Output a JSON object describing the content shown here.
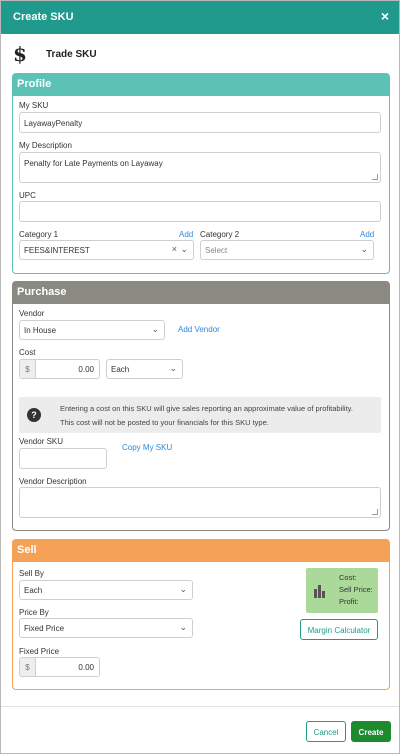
{
  "header": {
    "title": "Create SKU",
    "close_glyph": "×"
  },
  "sku_type": {
    "icon": "dollar-icon",
    "glyph": "$",
    "label": "Trade SKU"
  },
  "profile": {
    "title": "Profile",
    "my_sku_label": "My SKU",
    "my_sku_value": "LayawayPenalty",
    "description_label": "My Description",
    "description_value": "Penalty for Late Payments on Layaway",
    "upc_label": "UPC",
    "upc_value": "",
    "category1_label": "Category 1",
    "category1_add": "Add",
    "category1_value": "FEES&INTEREST",
    "category2_label": "Category 2",
    "category2_add": "Add",
    "category2_value": "Select"
  },
  "purchase": {
    "title": "Purchase",
    "vendor_label": "Vendor",
    "vendor_value": "In House",
    "add_vendor": "Add Vendor",
    "cost_label": "Cost",
    "currency_symbol": "$",
    "cost_value": "0.00",
    "cost_unit": "Each",
    "info_line1": "Entering a cost on this SKU will give sales reporting an approximate value of profitability.",
    "info_line2": "This cost will not be posted to your financials for this SKU type.",
    "vendor_sku_label": "Vendor SKU",
    "vendor_sku_value": "",
    "copy_my_sku": "Copy My SKU",
    "vendor_description_label": "Vendor Description",
    "vendor_description_value": ""
  },
  "sell": {
    "title": "Sell",
    "sell_by_label": "Sell By",
    "sell_by_value": "Each",
    "price_by_label": "Price By",
    "price_by_value": "Fixed Price",
    "fixed_price_label": "Fixed Price",
    "currency_symbol": "$",
    "fixed_price_value": "0.00",
    "summary_cost": "Cost:",
    "summary_sell_price": "Sell Price:",
    "summary_profit": "Profit:",
    "margin_calculator": "Margin Calculator"
  },
  "footer": {
    "cancel": "Cancel",
    "create": "Create"
  },
  "colors": {
    "header": "#1f9a8c",
    "profile": "#5cc2b6",
    "purchase": "#8a8a83",
    "sell": "#f5a158",
    "create_button": "#1e8a2e",
    "link": "#2a8ae0",
    "profit_box": "#aad99a"
  }
}
